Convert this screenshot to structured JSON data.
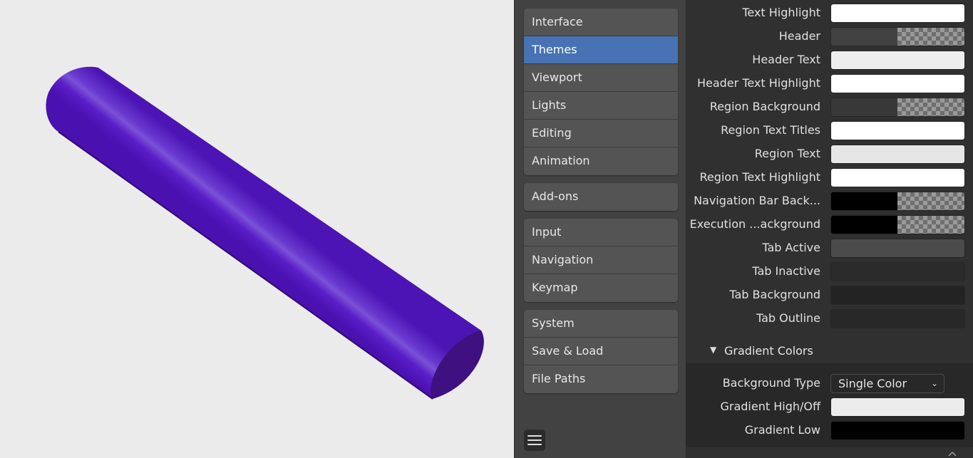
{
  "nav": {
    "groups": [
      [
        "Interface",
        "Themes",
        "Viewport",
        "Lights",
        "Editing",
        "Animation"
      ],
      [
        "Add-ons"
      ],
      [
        "Input",
        "Navigation",
        "Keymap"
      ],
      [
        "System",
        "Save & Load",
        "File Paths"
      ]
    ],
    "active": "Themes"
  },
  "props": {
    "rows": [
      {
        "label": "Text Highlight",
        "color": "#ffffff",
        "alpha": false
      },
      {
        "label": "Header",
        "color": "#424242",
        "alpha": true
      },
      {
        "label": "Header Text",
        "color": "#eeeeee",
        "alpha": false
      },
      {
        "label": "Header Text Highlight",
        "color": "#ffffff",
        "alpha": false
      },
      {
        "label": "Region Background",
        "color": "#383838",
        "alpha": true
      },
      {
        "label": "Region Text Titles",
        "color": "#ffffff",
        "alpha": false
      },
      {
        "label": "Region Text",
        "color": "#e6e6e6",
        "alpha": false
      },
      {
        "label": "Region Text Highlight",
        "color": "#ffffff",
        "alpha": false
      },
      {
        "label": "Navigation Bar Back...",
        "color": "#000000",
        "alpha": true
      },
      {
        "label": "Execution ...ackground",
        "color": "#000000",
        "alpha": true
      },
      {
        "label": "Tab Active",
        "color": "#4b4b4b",
        "alpha": false
      },
      {
        "label": "Tab Inactive",
        "color": "#2b2b2b",
        "alpha": false
      },
      {
        "label": "Tab Background",
        "color": "#232323",
        "alpha": false
      },
      {
        "label": "Tab Outline",
        "color": "#282828",
        "alpha": false
      }
    ],
    "section": {
      "title": "Gradient Colors",
      "background_type_label": "Background Type",
      "background_type_value": "Single Color",
      "gradient_high_label": "Gradient High/Off",
      "gradient_high_color": "#ececec",
      "gradient_low_label": "Gradient Low",
      "gradient_low_color": "#000000"
    }
  },
  "viewport": {
    "background": "#ebebeb",
    "object_color": "#5a1ec8"
  }
}
